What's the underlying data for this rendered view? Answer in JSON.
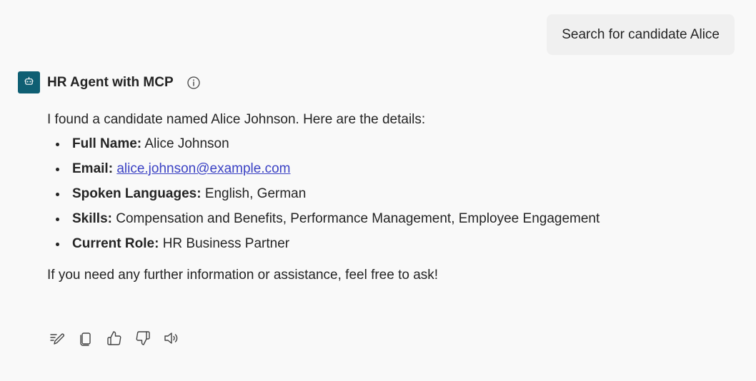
{
  "user_message": {
    "text": "Search for candidate Alice"
  },
  "agent": {
    "name": "HR Agent with MCP",
    "avatar_icon": "bot-icon",
    "avatar_color": "#0f5f73",
    "info_icon": "info-icon"
  },
  "response": {
    "intro": "I found a candidate named Alice Johnson. Here are the details:",
    "details": [
      {
        "label": "Full Name:",
        "value": "Alice Johnson"
      },
      {
        "label": "Email:",
        "value": "alice.johnson@example.com"
      },
      {
        "label": "Spoken Languages:",
        "value": "English, German"
      },
      {
        "label": "Skills:",
        "value": "Compensation and Benefits, Performance Management, Employee Engagement"
      },
      {
        "label": "Current Role:",
        "value": "HR Business Partner"
      }
    ],
    "outro": "If you need any further information or assistance, feel free to ask!",
    "link_color": "#3b42c4"
  },
  "actions": [
    {
      "icon": "edit-icon"
    },
    {
      "icon": "copy-icon"
    },
    {
      "icon": "thumbs-up-icon"
    },
    {
      "icon": "thumbs-down-icon"
    },
    {
      "icon": "read-aloud-icon"
    }
  ]
}
